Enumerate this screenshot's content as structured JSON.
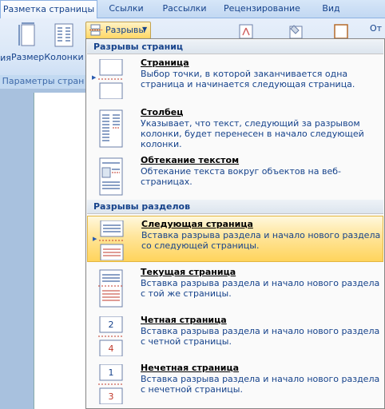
{
  "tabs": [
    {
      "label": "Разметка страницы",
      "active": true
    },
    {
      "label": "Ссылки"
    },
    {
      "label": "Рассылки"
    },
    {
      "label": "Рецензирование"
    },
    {
      "label": "Вид"
    }
  ],
  "ribbon": {
    "buttons": [
      {
        "label": "ия"
      },
      {
        "label": "Размер"
      },
      {
        "label": "Колонки"
      }
    ],
    "group_label": "Параметры стран",
    "breaks_button": "Разрывы",
    "right_label": "От"
  },
  "menu": {
    "page_breaks_header": "Разрывы страниц",
    "section_breaks_header": "Разрывы разделов",
    "page_items": [
      {
        "title": "Страница",
        "desc": "Выбор точки, в которой заканчивается одна страница и начинается следующая страница."
      },
      {
        "title": "Столбец",
        "desc": "Указывает, что текст, следующий за разрывом колонки, будет перенесен в начало следующей колонки."
      },
      {
        "title": "Обтекание текстом",
        "desc": "Обтекание текста вокруг объектов на веб-страницах."
      }
    ],
    "section_items": [
      {
        "title": "Следующая страница",
        "desc": "Вставка разрыва раздела и начало нового раздела со следующей страницы."
      },
      {
        "title": "Текущая страница",
        "desc": "Вставка разрыва раздела и начало нового раздела с той же страницы."
      },
      {
        "title": "Четная страница",
        "desc": "Вставка разрыва раздела и начало нового раздела с четной страницы.",
        "badge_top": "2",
        "badge_bottom": "4"
      },
      {
        "title": "Нечетная страница",
        "desc": "Вставка разрыва раздела и начало нового раздела с нечетной страницы.",
        "badge_top": "1",
        "badge_bottom": "3"
      }
    ]
  },
  "colors": {
    "accent": "#15428b",
    "highlight": "#ffd45c",
    "break_mark": "#c0392b"
  }
}
